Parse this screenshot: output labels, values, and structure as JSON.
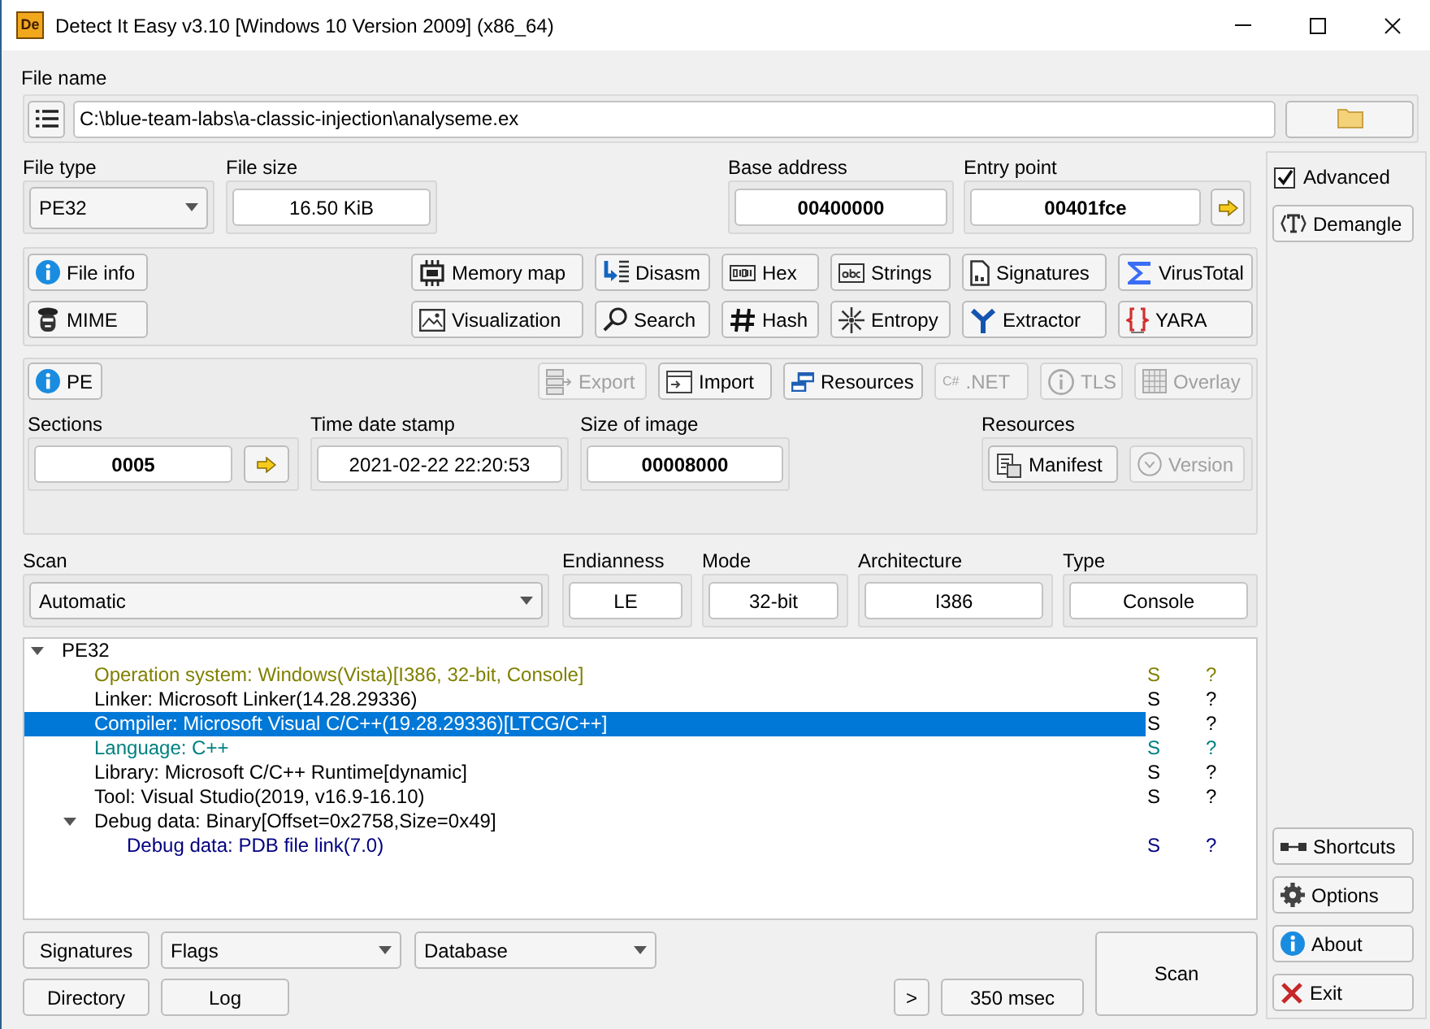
{
  "window": {
    "logo": "De",
    "title": "Detect It Easy v3.10 [Windows 10 Version 2009] (x86_64)"
  },
  "file_name": {
    "label": "File name",
    "value": "C:\\blue-team-labs\\a-classic-injection\\analyseme.ex"
  },
  "file_type": {
    "label": "File type",
    "value": "PE32"
  },
  "file_size": {
    "label": "File size",
    "value": "16.50 KiB"
  },
  "base_address": {
    "label": "Base address",
    "value": "00400000"
  },
  "entry_point": {
    "label": "Entry point",
    "value": "00401fce"
  },
  "advanced": {
    "label": "Advanced",
    "checked": true
  },
  "demangle_button": "Demangle",
  "tool_buttons": [
    [
      "File info",
      "Memory map",
      "Disasm",
      "Hex",
      "Strings",
      "Signatures",
      "VirusTotal"
    ],
    [
      "MIME",
      "Visualization",
      "Search",
      "Hash",
      "Entropy",
      "Extractor",
      "YARA"
    ]
  ],
  "pe_panel": {
    "info_button": "PE",
    "buttons": [
      {
        "label": "Export",
        "disabled": true
      },
      {
        "label": "Import",
        "disabled": false
      },
      {
        "label": "Resources",
        "disabled": false
      },
      {
        "label": ".NET",
        "glyph": "C#",
        "disabled": true
      },
      {
        "label": "TLS",
        "disabled": true
      },
      {
        "label": "Overlay",
        "disabled": true
      }
    ],
    "sections": {
      "label": "Sections",
      "value": "0005"
    },
    "time_date_stamp": {
      "label": "Time date stamp",
      "value": "2021-02-22 22:20:53"
    },
    "size_of_image": {
      "label": "Size of image",
      "value": "00008000"
    },
    "resources": {
      "label": "Resources",
      "buttons": [
        {
          "label": "Manifest",
          "disabled": false
        },
        {
          "label": "Version",
          "disabled": true
        }
      ]
    }
  },
  "scan": {
    "label": "Scan",
    "value": "Automatic"
  },
  "properties": [
    {
      "label": "Endianness",
      "value": "LE"
    },
    {
      "label": "Mode",
      "value": "32-bit"
    },
    {
      "label": "Architecture",
      "value": "I386"
    },
    {
      "label": "Type",
      "value": "Console"
    }
  ],
  "results": [
    {
      "label": "PE32",
      "color": "#000000",
      "selected": false,
      "expanded": true,
      "children": [
        {
          "label": "Operation system: Windows(Vista)[I386, 32-bit, Console]",
          "color": "#808000",
          "selected": false,
          "column_2": "S",
          "column_3": "?"
        },
        {
          "label": "Linker: Microsoft Linker(14.28.29336)",
          "color": "#000000",
          "selected": false,
          "column_2": "S",
          "column_3": "?"
        },
        {
          "label": "Compiler: Microsoft Visual C/C++(19.28.29336)[LTCG/C++]",
          "color": "#000000",
          "selected": true,
          "column_2": "S",
          "column_3": "?"
        },
        {
          "label": "Language: C++",
          "color": "#008080",
          "selected": false,
          "column_2": "S",
          "column_3": "?"
        },
        {
          "label": "Library: Microsoft C/C++ Runtime[dynamic]",
          "color": "#000000",
          "selected": false,
          "column_2": "S",
          "column_3": "?"
        },
        {
          "label": "Tool: Visual Studio(2019, v16.9-16.10)",
          "color": "#000000",
          "selected": false,
          "column_2": "S",
          "column_3": "?"
        },
        {
          "label": "Debug data: Binary[Offset=0x2758,Size=0x49]",
          "color": "#000000",
          "selected": false,
          "expanded": true,
          "children": [
            {
              "label": "Debug data: PDB file link(7.0)",
              "color": "#000080",
              "selected": false,
              "column_2": "S",
              "column_3": "?"
            }
          ]
        }
      ]
    }
  ],
  "bottom_bar": {
    "signatures_button": "Signatures",
    "flags": "Flags",
    "database": "Database",
    "directory_button": "Directory",
    "log_button": "Log",
    "more_button": ">",
    "elapsed": "350 msec",
    "scan_button": "Scan"
  },
  "side_buttons": [
    "Shortcuts",
    "Options",
    "About",
    "Exit"
  ]
}
